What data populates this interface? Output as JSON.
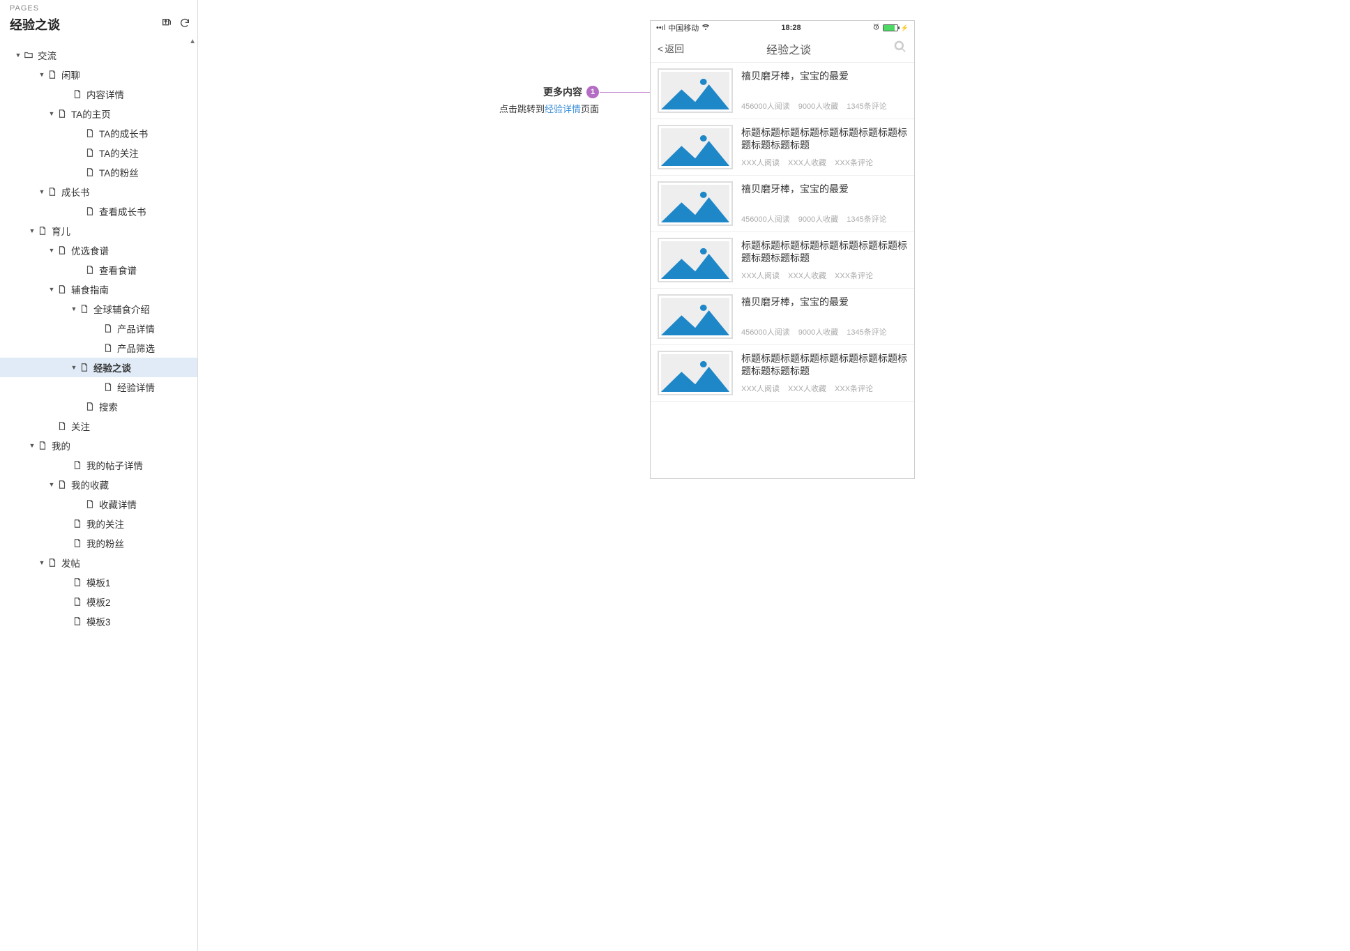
{
  "sidebar": {
    "section_label": "PAGES",
    "title": "经验之谈",
    "items": [
      {
        "caret": true,
        "icon": "folder",
        "label": "交流",
        "indent": 20
      },
      {
        "caret": true,
        "icon": "page",
        "label": "闲聊",
        "indent": 54
      },
      {
        "caret": false,
        "icon": "page",
        "label": "内容详情",
        "indent": 90
      },
      {
        "caret": true,
        "icon": "page",
        "label": "TA的主页",
        "indent": 68
      },
      {
        "caret": false,
        "icon": "page",
        "label": "TA的成长书",
        "indent": 108
      },
      {
        "caret": false,
        "icon": "page",
        "label": "TA的关注",
        "indent": 108
      },
      {
        "caret": false,
        "icon": "page",
        "label": "TA的粉丝",
        "indent": 108
      },
      {
        "caret": true,
        "icon": "page",
        "label": "成长书",
        "indent": 54
      },
      {
        "caret": false,
        "icon": "page",
        "label": "查看成长书",
        "indent": 108
      },
      {
        "caret": true,
        "icon": "page",
        "label": "育儿",
        "indent": 40
      },
      {
        "caret": true,
        "icon": "page",
        "label": "优选食谱",
        "indent": 68
      },
      {
        "caret": false,
        "icon": "page",
        "label": "查看食谱",
        "indent": 108
      },
      {
        "caret": true,
        "icon": "page",
        "label": "辅食指南",
        "indent": 68
      },
      {
        "caret": true,
        "icon": "page",
        "label": "全球辅食介绍",
        "indent": 100
      },
      {
        "caret": false,
        "icon": "page",
        "label": "产品详情",
        "indent": 134
      },
      {
        "caret": false,
        "icon": "page",
        "label": "产品筛选",
        "indent": 134
      },
      {
        "caret": true,
        "icon": "page",
        "label": "经验之谈",
        "indent": 100,
        "selected": true
      },
      {
        "caret": false,
        "icon": "page",
        "label": "经验详情",
        "indent": 134
      },
      {
        "caret": false,
        "icon": "page",
        "label": "搜索",
        "indent": 108
      },
      {
        "caret": false,
        "icon": "page",
        "label": "关注",
        "indent": 68
      },
      {
        "caret": true,
        "icon": "page",
        "label": "我的",
        "indent": 40
      },
      {
        "caret": false,
        "icon": "page",
        "label": "我的帖子详情",
        "indent": 90
      },
      {
        "caret": true,
        "icon": "page",
        "label": "我的收藏",
        "indent": 68
      },
      {
        "caret": false,
        "icon": "page",
        "label": "收藏详情",
        "indent": 108
      },
      {
        "caret": false,
        "icon": "page",
        "label": "我的关注",
        "indent": 90
      },
      {
        "caret": false,
        "icon": "page",
        "label": "我的粉丝",
        "indent": 90
      },
      {
        "caret": true,
        "icon": "page",
        "label": "发帖",
        "indent": 54
      },
      {
        "caret": false,
        "icon": "page",
        "label": "模板1",
        "indent": 90
      },
      {
        "caret": false,
        "icon": "page",
        "label": "模板2",
        "indent": 90
      },
      {
        "caret": false,
        "icon": "page",
        "label": "模板3",
        "indent": 90
      }
    ]
  },
  "annotation": {
    "title": "更多内容",
    "badge": "1",
    "sub_prefix": "点击跳转到",
    "sub_link": "经验详情",
    "sub_suffix": "页面"
  },
  "phone": {
    "statusbar": {
      "signal": "••ıl",
      "carrier": "中国移动",
      "time": "18:28"
    },
    "navbar": {
      "back": "返回",
      "title": "经验之谈"
    },
    "rows": [
      {
        "title": "禧贝磨牙棒，宝宝的最爱",
        "reads": "456000人阅读",
        "favs": "9000人收藏",
        "comments": "1345条评论"
      },
      {
        "title": "标题标题标题标题标题标题标题标题标题标题标题标题",
        "reads": "XXX人阅读",
        "favs": "XXX人收藏",
        "comments": "XXX条评论"
      },
      {
        "title": "禧贝磨牙棒，宝宝的最爱",
        "reads": "456000人阅读",
        "favs": "9000人收藏",
        "comments": "1345条评论"
      },
      {
        "title": "标题标题标题标题标题标题标题标题标题标题标题标题",
        "reads": "XXX人阅读",
        "favs": "XXX人收藏",
        "comments": "XXX条评论"
      },
      {
        "title": "禧贝磨牙棒，宝宝的最爱",
        "reads": "456000人阅读",
        "favs": "9000人收藏",
        "comments": "1345条评论"
      },
      {
        "title": "标题标题标题标题标题标题标题标题标题标题标题标题",
        "reads": "XXX人阅读",
        "favs": "XXX人收藏",
        "comments": "XXX条评论"
      }
    ]
  }
}
